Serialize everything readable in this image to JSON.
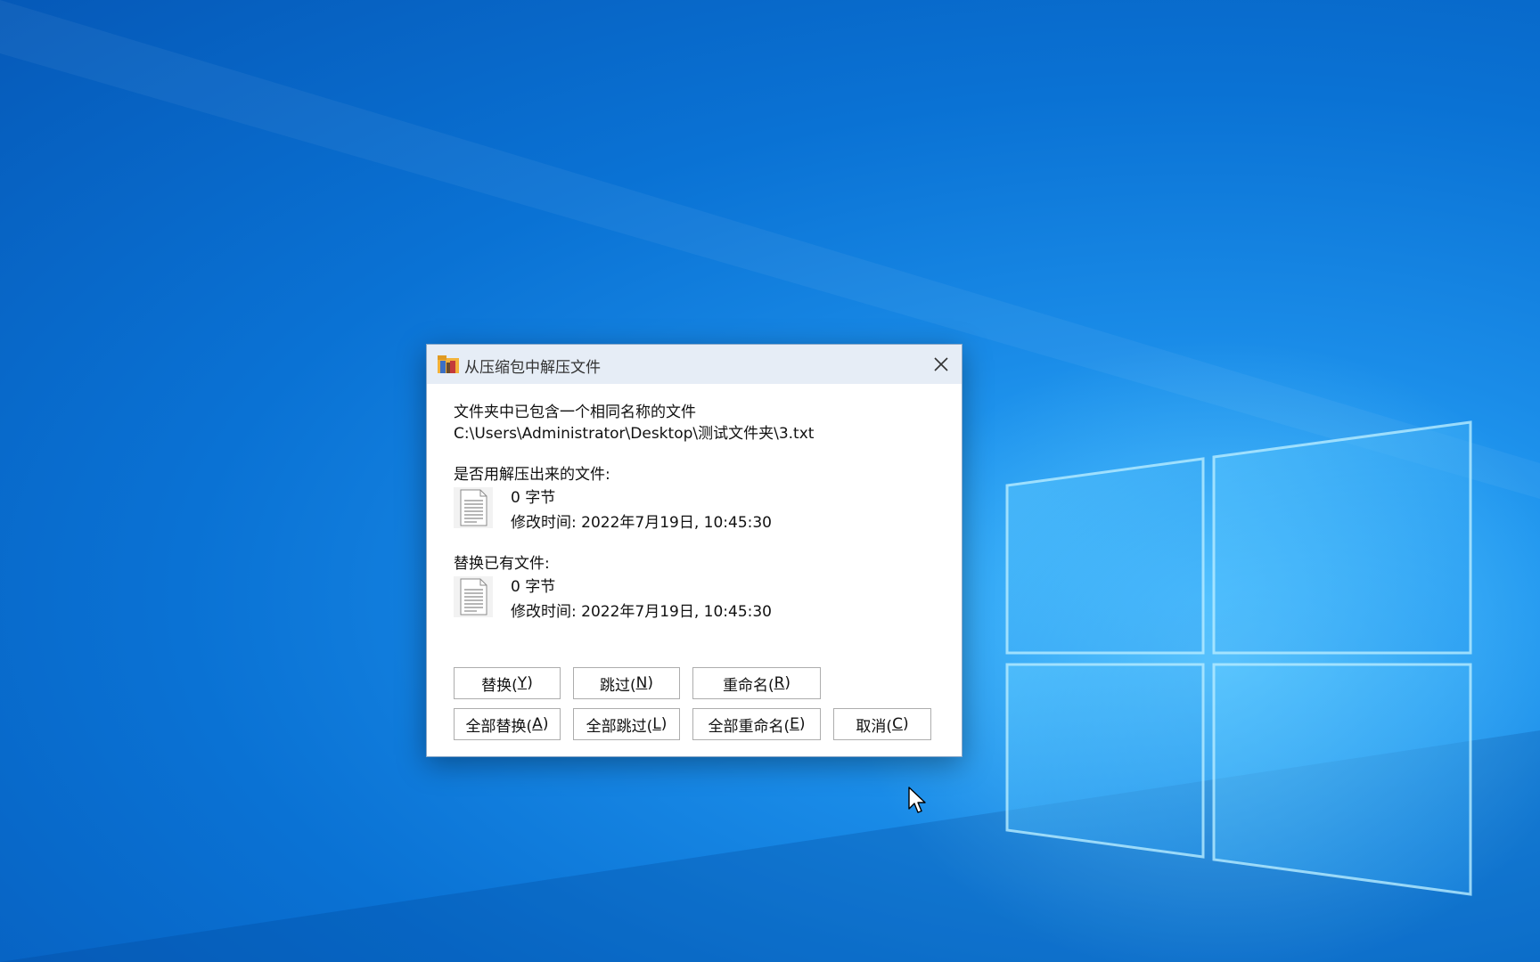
{
  "dialog": {
    "title": "从压缩包中解压文件",
    "message_line1": "文件夹中已包含一个相同名称的文件",
    "message_path": "C:\\Users\\Administrator\\Desktop\\测试文件夹\\3.txt",
    "extracted_heading": "是否用解压出来的文件:",
    "extracted_size": "0 字节",
    "extracted_modified": "修改时间: 2022年7月19日, 10:45:30",
    "existing_heading": "替换已有文件:",
    "existing_size": "0 字节",
    "existing_modified": "修改时间: 2022年7月19日, 10:45:30"
  },
  "buttons": {
    "replace": {
      "text": "替换(",
      "key": "Y",
      "end": ")"
    },
    "skip": {
      "text": "跳过(",
      "key": "N",
      "end": ")"
    },
    "rename": {
      "text": "重命名(",
      "key": "R",
      "end": ")"
    },
    "replace_all": {
      "text": "全部替换(",
      "key": "A",
      "end": ")"
    },
    "skip_all": {
      "text": "全部跳过(",
      "key": "L",
      "end": ")"
    },
    "rename_all": {
      "text": "全部重命名(",
      "key": "E",
      "end": ")"
    },
    "cancel": {
      "text": "取消(",
      "key": "C",
      "end": ")"
    }
  },
  "icons": {
    "title": "archive-folder-icon",
    "close": "close-icon",
    "file": "text-file-icon",
    "cursor": "mouse-pointer-icon"
  },
  "colors": {
    "desktop_accent": "#1a8ce8",
    "titlebar": "#e6edf6",
    "dialog_bg": "#ffffff"
  }
}
